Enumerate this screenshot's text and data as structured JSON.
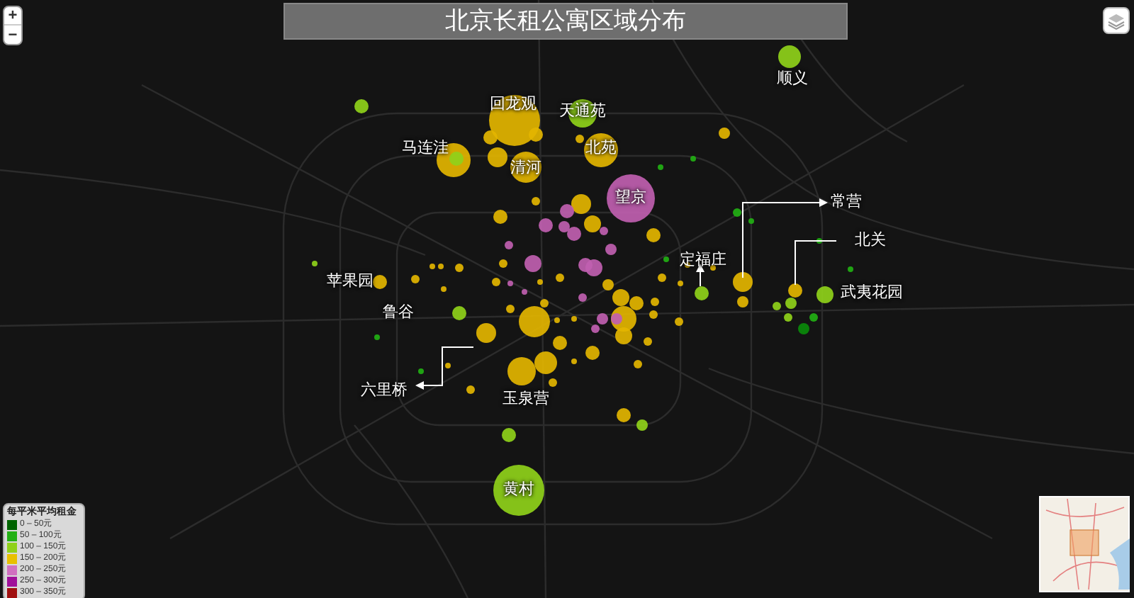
{
  "title": "北京长租公寓区域分布",
  "zoom_controls": [
    "+",
    "−"
  ],
  "places": [
    {
      "label": "顺义"
    },
    {
      "label": "回龙观"
    },
    {
      "label": "天通苑"
    },
    {
      "label": "马连洼"
    },
    {
      "label": "北苑"
    },
    {
      "label": "清河"
    },
    {
      "label": "望京"
    },
    {
      "label": "常营"
    },
    {
      "label": "北关"
    },
    {
      "label": "定福庄"
    },
    {
      "label": "苹果园"
    },
    {
      "label": "武夷花园"
    },
    {
      "label": "鲁谷"
    },
    {
      "label": "六里桥"
    },
    {
      "label": "玉泉营"
    },
    {
      "label": "黄村"
    }
  ],
  "legend": {
    "title": "每平米平均租金",
    "items": [
      {
        "label": "0 – 50元",
        "color": "#006400"
      },
      {
        "label": "50 – 100元",
        "color": "#22b014"
      },
      {
        "label": "100 – 150元",
        "color": "#8fd11a"
      },
      {
        "label": "150 – 200元",
        "color": "#e8c000"
      },
      {
        "label": "200 – 250元",
        "color": "#d070c0"
      },
      {
        "label": "250 – 300元",
        "color": "#a0109a"
      },
      {
        "label": "300 – 350元",
        "color": "#a01010"
      }
    ]
  }
}
